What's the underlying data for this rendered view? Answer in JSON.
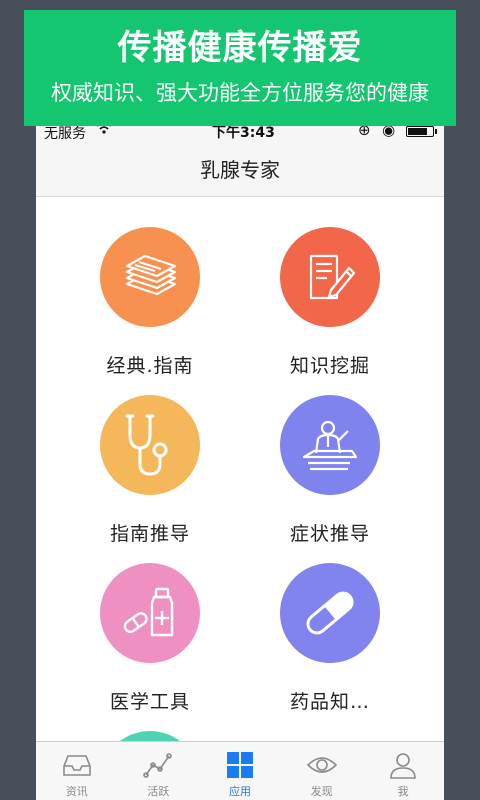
{
  "banner": {
    "title": "传播健康传播爱",
    "subtitle": "权威知识、强大功能全方位服务您的健康"
  },
  "statusbar": {
    "carrier": "无服务",
    "time": "下午3:43",
    "battery_level": 0.85
  },
  "navbar": {
    "title": "乳腺专家"
  },
  "tiles": [
    {
      "label": "经典.指南",
      "icon": "stacked-papers-icon",
      "color": "#f8914f"
    },
    {
      "label": "知识挖掘",
      "icon": "document-edit-icon",
      "color": "#f2664a"
    },
    {
      "label": "指南推导",
      "icon": "stethoscope-icon",
      "color": "#f4b85b"
    },
    {
      "label": "症状推导",
      "icon": "doctor-presenting-icon",
      "color": "#7f83ee"
    },
    {
      "label": "医学工具",
      "icon": "medicine-bottle-icon",
      "color": "#ef90c2"
    },
    {
      "label": "药品知…",
      "icon": "capsule-icon",
      "color": "#8184ee"
    },
    {
      "label": "",
      "icon": "partial-tile",
      "color": "#4ed4b3"
    }
  ],
  "tabbar": {
    "active_color": "#1a7cf5",
    "items": [
      {
        "label": "资讯",
        "icon": "inbox-tray-icon"
      },
      {
        "label": "活跃",
        "icon": "activity-graph-icon"
      },
      {
        "label": "应用",
        "icon": "apps-grid-icon",
        "active": true
      },
      {
        "label": "发现",
        "icon": "eye-icon"
      },
      {
        "label": "我",
        "icon": "user-icon"
      }
    ]
  }
}
